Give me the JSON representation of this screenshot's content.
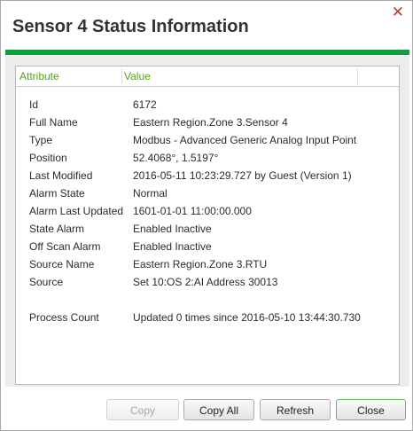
{
  "dialog": {
    "title": "Sensor 4 Status Information",
    "close_glyph": "✕",
    "accent_color": "#0f9f3a"
  },
  "grid": {
    "columns": [
      "Attribute",
      "Value"
    ],
    "rows": [
      {
        "attribute": "Id",
        "value": "6172"
      },
      {
        "attribute": "Full Name",
        "value": "Eastern Region.Zone 3.Sensor 4"
      },
      {
        "attribute": "Type",
        "value": "Modbus - Advanced Generic Analog Input Point"
      },
      {
        "attribute": "Position",
        "value": "52.4068°, 1.5197°"
      },
      {
        "attribute": "Last Modified",
        "value": "2016-05-11 10:23:29.727 by Guest (Version 1)"
      },
      {
        "attribute": "Alarm State",
        "value": "Normal"
      },
      {
        "attribute": "Alarm Last Updated",
        "value": "1601-01-01 11:00:00.000"
      },
      {
        "attribute": "State Alarm",
        "value": "Enabled Inactive"
      },
      {
        "attribute": "Off Scan Alarm",
        "value": "Enabled Inactive"
      },
      {
        "attribute": "Source Name",
        "value": "Eastern Region.Zone 3.RTU"
      },
      {
        "attribute": "Source",
        "value": "Set 10:OS 2:AI Address 30013"
      },
      {
        "attribute": "Process Count",
        "value": "Updated 0 times since 2016-05-10 13:44:30.730"
      }
    ]
  },
  "buttons": {
    "copy": "Copy",
    "copy_all": "Copy All",
    "refresh": "Refresh",
    "close": "Close"
  }
}
